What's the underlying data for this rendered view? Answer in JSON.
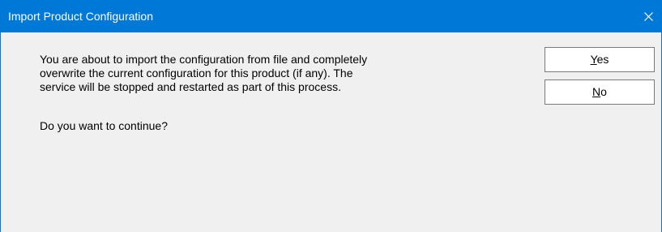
{
  "window": {
    "title": "Import Product Configuration"
  },
  "icons": {
    "close": "close-icon"
  },
  "message": {
    "body": "You are about to import the configuration from file and completely\noverwrite the current configuration for this product (if any).  The\nservice will be stopped and restarted as part of this process.",
    "question": "Do you want to continue?"
  },
  "buttons": {
    "yes": {
      "mnemonic": "Y",
      "rest": "es"
    },
    "no": {
      "mnemonic": "N",
      "rest": "o"
    }
  },
  "colors": {
    "titlebar": "#0078d7",
    "background": "#f0f0f0"
  }
}
